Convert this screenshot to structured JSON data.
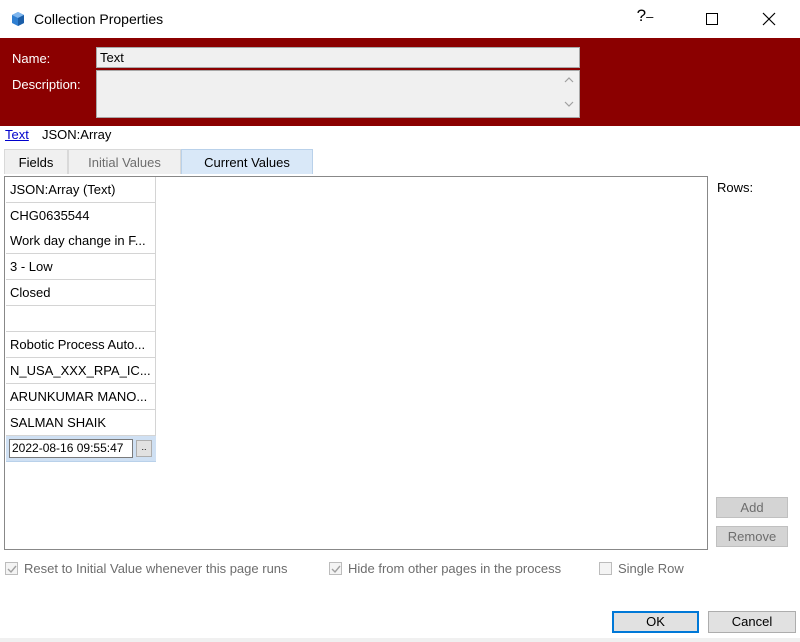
{
  "window": {
    "title": "Collection Properties",
    "help_label": "?",
    "icon": "blueprism-app-icon"
  },
  "header": {
    "name_label": "Name:",
    "name_value": "Text",
    "description_label": "Description:",
    "description_value": ""
  },
  "breadcrumb": {
    "link": "Text",
    "current": "JSON:Array"
  },
  "tabs": [
    {
      "label": "Fields"
    },
    {
      "label": "Initial Values"
    },
    {
      "label": "Current Values"
    }
  ],
  "grid": {
    "column_header": "JSON:Array  (Text)",
    "rows": [
      "CHG0635544",
      "Work day change in F...",
      "3 - Low",
      "Closed",
      "",
      "Robotic Process Auto...",
      "N_USA_XXX_RPA_IC...",
      "ARUNKUMAR MANO...",
      "SALMAN SHAIK"
    ],
    "editing_value": "2022-08-16 09:55:47",
    "edit_button_label": ".."
  },
  "side": {
    "rows_label": "Rows:",
    "add_label": "Add",
    "remove_label": "Remove"
  },
  "options": {
    "reset_label": "Reset to Initial Value whenever this page runs",
    "hide_label": "Hide from other pages in the process",
    "single_row_label": "Single Row"
  },
  "footer": {
    "ok_label": "OK",
    "cancel_label": "Cancel"
  }
}
